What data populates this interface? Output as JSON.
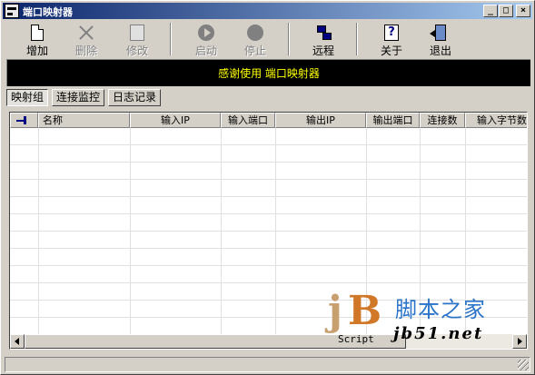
{
  "window": {
    "title": "端口映射器",
    "controls": {
      "minimize": "_",
      "maximize": "□",
      "close": "×"
    }
  },
  "toolbar": {
    "add_label": "增加",
    "delete_label": "删除",
    "edit_label": "修改",
    "start_label": "启动",
    "stop_label": "停止",
    "remote_label": "远程",
    "about_label": "关于",
    "exit_label": "退出"
  },
  "banner": {
    "text": "感谢使用 端口映射器"
  },
  "tabs": [
    {
      "label": "映射组"
    },
    {
      "label": "连接监控"
    },
    {
      "label": "日志记录"
    }
  ],
  "table": {
    "columns": [
      "名称",
      "输入IP",
      "输入端口",
      "输出IP",
      "输出端口",
      "连接数",
      "输入字节数"
    ],
    "rows": []
  },
  "watermark": {
    "logo_j": "j",
    "logo_b": "B",
    "script": "Script",
    "site_cn": "脚本之家",
    "site_url": "jb51.net"
  },
  "colors": {
    "banner_bg": "#000000",
    "banner_text": "#ffff00",
    "title_start": "#0a246a",
    "title_end": "#a6caf0",
    "face": "#d4d0c8"
  }
}
